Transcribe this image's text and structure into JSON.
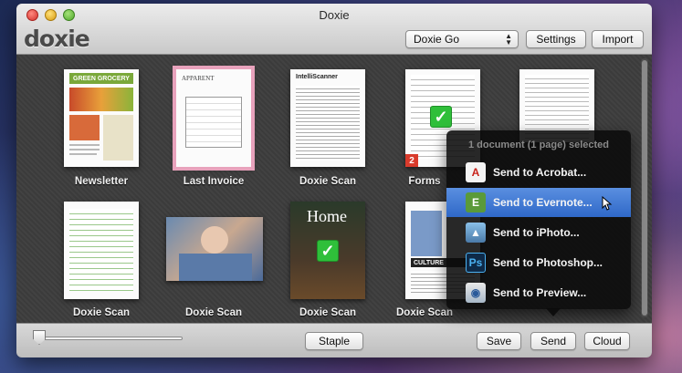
{
  "window": {
    "title": "Doxie"
  },
  "app": {
    "logo": "doxie"
  },
  "toolbar": {
    "source_select": "Doxie Go",
    "settings_label": "Settings",
    "import_label": "Import"
  },
  "scans": [
    {
      "label": "Newsletter",
      "selected": false
    },
    {
      "label": "Last Invoice",
      "selected": true
    },
    {
      "label": "Doxie Scan",
      "selected": false
    },
    {
      "label": "Forms",
      "selected": false,
      "badge": "2",
      "checked": true
    },
    {
      "label": "",
      "selected": false
    },
    {
      "label": "Doxie Scan",
      "selected": false
    },
    {
      "label": "Doxie Scan",
      "selected": false
    },
    {
      "label": "Doxie Scan",
      "selected": false,
      "checked": true
    },
    {
      "label": "Doxie Scan",
      "selected": false
    },
    {
      "label": "",
      "selected": false
    }
  ],
  "thumb_text": {
    "newsletter_banner": "GREEN GROCERY",
    "invoice_logo": "APPARENT",
    "doxie_logo": "IntelliScanner",
    "home_magazine": "Home",
    "culture_magazine": "CULTURE"
  },
  "popover": {
    "header": "1 document (1 page) selected",
    "items": [
      {
        "label": "Send to Acrobat...",
        "icon": "acrobat-icon",
        "highlighted": false
      },
      {
        "label": "Send to Evernote...",
        "icon": "evernote-icon",
        "highlighted": true
      },
      {
        "label": "Send to iPhoto...",
        "icon": "iphoto-icon",
        "highlighted": false
      },
      {
        "label": "Send to Photoshop...",
        "icon": "photoshop-icon",
        "highlighted": false
      },
      {
        "label": "Send to Preview...",
        "icon": "preview-icon",
        "highlighted": false
      }
    ]
  },
  "bottom": {
    "staple_label": "Staple",
    "save_label": "Save",
    "send_label": "Send",
    "cloud_label": "Cloud",
    "zoom_level": 0
  },
  "colors": {
    "selection_outline": "#e8a2bc",
    "highlight": "#3a74d4",
    "check": "#2fbf3a"
  }
}
